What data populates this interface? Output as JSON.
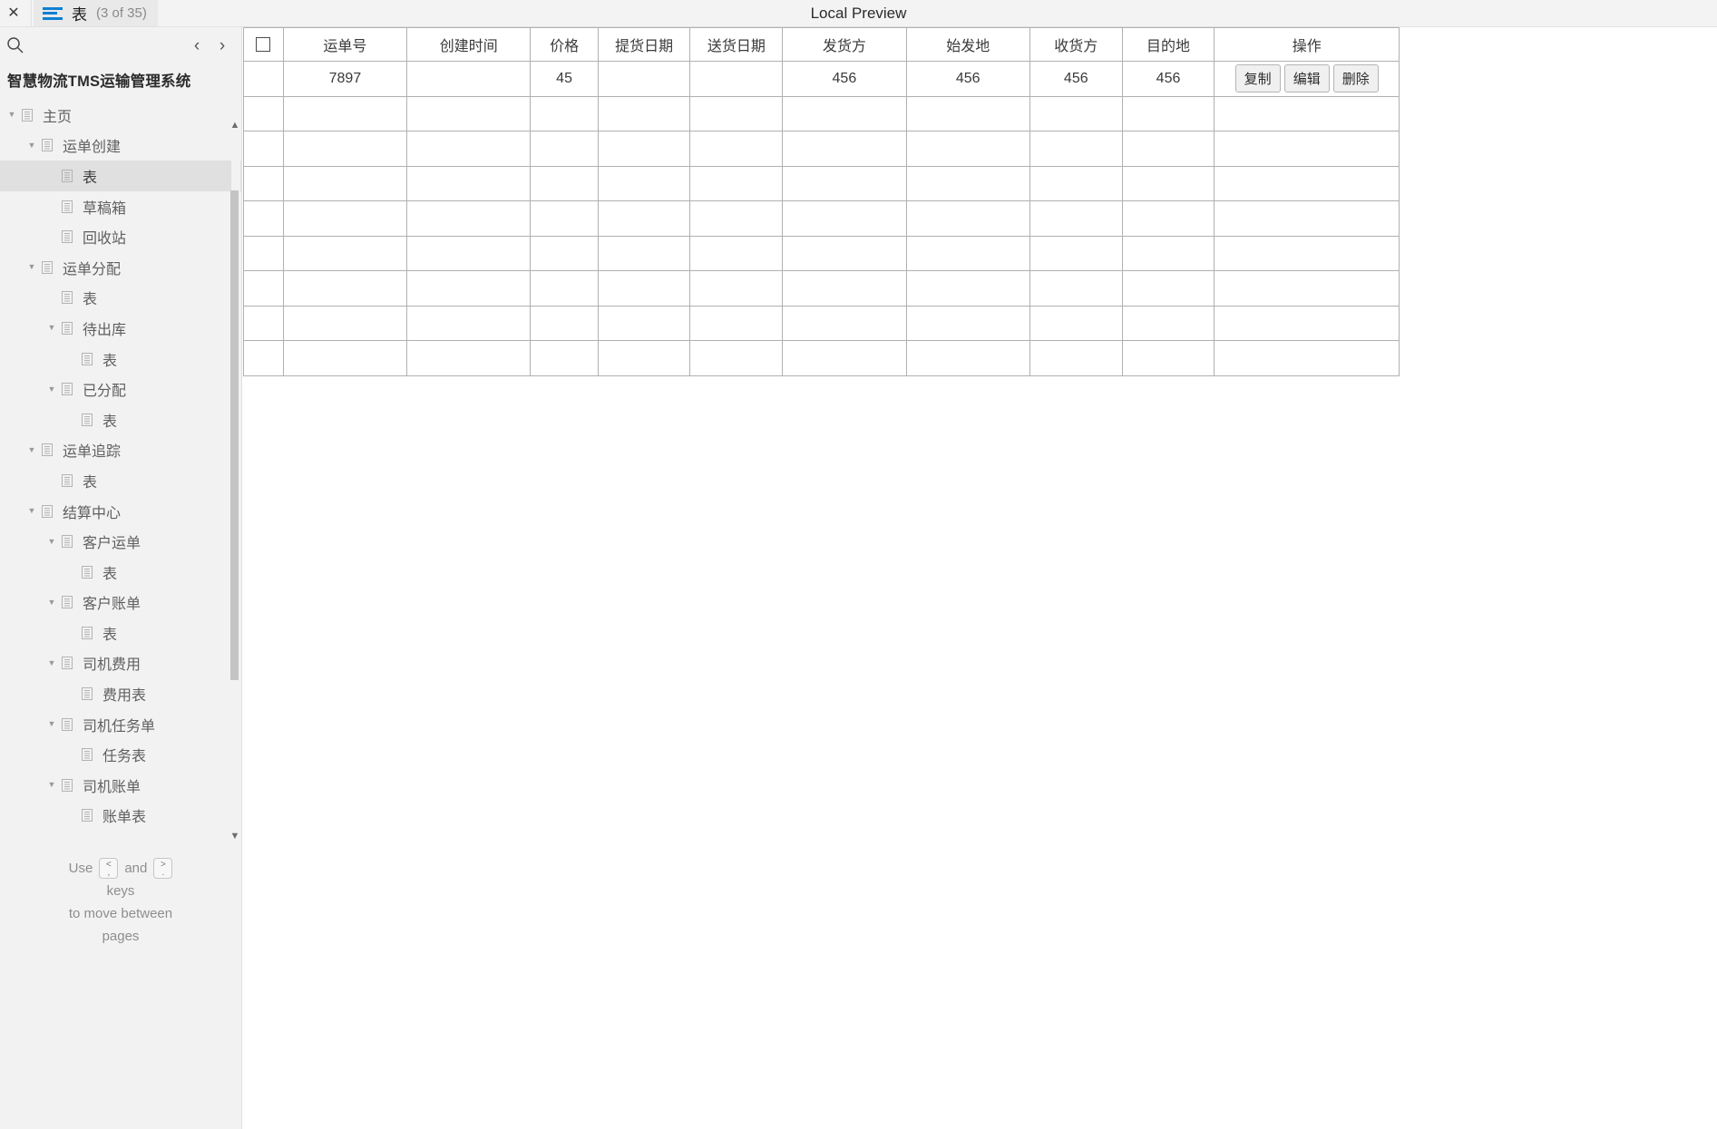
{
  "topbar": {
    "close_label": "✕",
    "tab_icon": "list-icon",
    "tab_title": "表",
    "tab_count": "(3 of 35)",
    "preview_title": "Local Preview"
  },
  "sidebar": {
    "search_icon": "search-icon",
    "prev_label": "‹",
    "next_label": "›",
    "app_title": "智慧物流TMS运输管理系统",
    "items": [
      {
        "label": "主页",
        "depth": 0,
        "twisty": "▼",
        "selected": false
      },
      {
        "label": "运单创建",
        "depth": 1,
        "twisty": "▼",
        "selected": false
      },
      {
        "label": "表",
        "depth": 2,
        "twisty": "",
        "selected": true
      },
      {
        "label": "草稿箱",
        "depth": 2,
        "twisty": "",
        "selected": false
      },
      {
        "label": "回收站",
        "depth": 2,
        "twisty": "",
        "selected": false
      },
      {
        "label": "运单分配",
        "depth": 1,
        "twisty": "▼",
        "selected": false
      },
      {
        "label": "表",
        "depth": 2,
        "twisty": "",
        "selected": false
      },
      {
        "label": "待出库",
        "depth": 2,
        "twisty": "▼",
        "selected": false
      },
      {
        "label": "表",
        "depth": 3,
        "twisty": "",
        "selected": false
      },
      {
        "label": "已分配",
        "depth": 2,
        "twisty": "▼",
        "selected": false
      },
      {
        "label": "表",
        "depth": 3,
        "twisty": "",
        "selected": false
      },
      {
        "label": "运单追踪",
        "depth": 1,
        "twisty": "▼",
        "selected": false
      },
      {
        "label": "表",
        "depth": 2,
        "twisty": "",
        "selected": false
      },
      {
        "label": "结算中心",
        "depth": 1,
        "twisty": "▼",
        "selected": false
      },
      {
        "label": "客户运单",
        "depth": 2,
        "twisty": "▼",
        "selected": false
      },
      {
        "label": "表",
        "depth": 3,
        "twisty": "",
        "selected": false
      },
      {
        "label": "客户账单",
        "depth": 2,
        "twisty": "▼",
        "selected": false
      },
      {
        "label": "表",
        "depth": 3,
        "twisty": "",
        "selected": false
      },
      {
        "label": "司机费用",
        "depth": 2,
        "twisty": "▼",
        "selected": false
      },
      {
        "label": "费用表",
        "depth": 3,
        "twisty": "",
        "selected": false
      },
      {
        "label": "司机任务单",
        "depth": 2,
        "twisty": "▼",
        "selected": false
      },
      {
        "label": "任务表",
        "depth": 3,
        "twisty": "",
        "selected": false
      },
      {
        "label": "司机账单",
        "depth": 2,
        "twisty": "▼",
        "selected": false
      },
      {
        "label": "账单表",
        "depth": 3,
        "twisty": "",
        "selected": false
      }
    ],
    "page_hint": {
      "use": "Use",
      "key_prev_top": "<",
      "key_prev_bottom": ",",
      "and": "and",
      "key_next_top": ">",
      "key_next_bottom": ".",
      "keys": "keys",
      "line2": "to move between",
      "line3": "pages"
    }
  },
  "table": {
    "select_all_checkbox": "checkbox",
    "headers": [
      "",
      "运单号",
      "创建时间",
      "价格",
      "提货日期",
      "送货日期",
      "发货方",
      "始发地",
      "收货方",
      "目的地",
      "操作"
    ],
    "rows": [
      {
        "cells": [
          "",
          "7897",
          "",
          "45",
          "",
          "",
          "456",
          "456",
          "456",
          "456"
        ],
        "actions": [
          "复制",
          "编辑",
          "删除"
        ]
      },
      {
        "cells": [
          "",
          "",
          "",
          "",
          "",
          "",
          "",
          "",
          "",
          ""
        ],
        "actions": []
      },
      {
        "cells": [
          "",
          "",
          "",
          "",
          "",
          "",
          "",
          "",
          "",
          ""
        ],
        "actions": []
      },
      {
        "cells": [
          "",
          "",
          "",
          "",
          "",
          "",
          "",
          "",
          "",
          ""
        ],
        "actions": []
      },
      {
        "cells": [
          "",
          "",
          "",
          "",
          "",
          "",
          "",
          "",
          "",
          ""
        ],
        "actions": []
      },
      {
        "cells": [
          "",
          "",
          "",
          "",
          "",
          "",
          "",
          "",
          "",
          ""
        ],
        "actions": []
      },
      {
        "cells": [
          "",
          "",
          "",
          "",
          "",
          "",
          "",
          "",
          "",
          ""
        ],
        "actions": []
      },
      {
        "cells": [
          "",
          "",
          "",
          "",
          "",
          "",
          "",
          "",
          "",
          ""
        ],
        "actions": []
      },
      {
        "cells": [
          "",
          "",
          "",
          "",
          "",
          "",
          "",
          "",
          "",
          ""
        ],
        "actions": []
      }
    ]
  },
  "colors": {
    "accent": "#0b7fd4",
    "sidebar_bg": "#f2f2f2",
    "selected_bg": "#e0e0e0",
    "grid_line": "#b0b0b0"
  }
}
